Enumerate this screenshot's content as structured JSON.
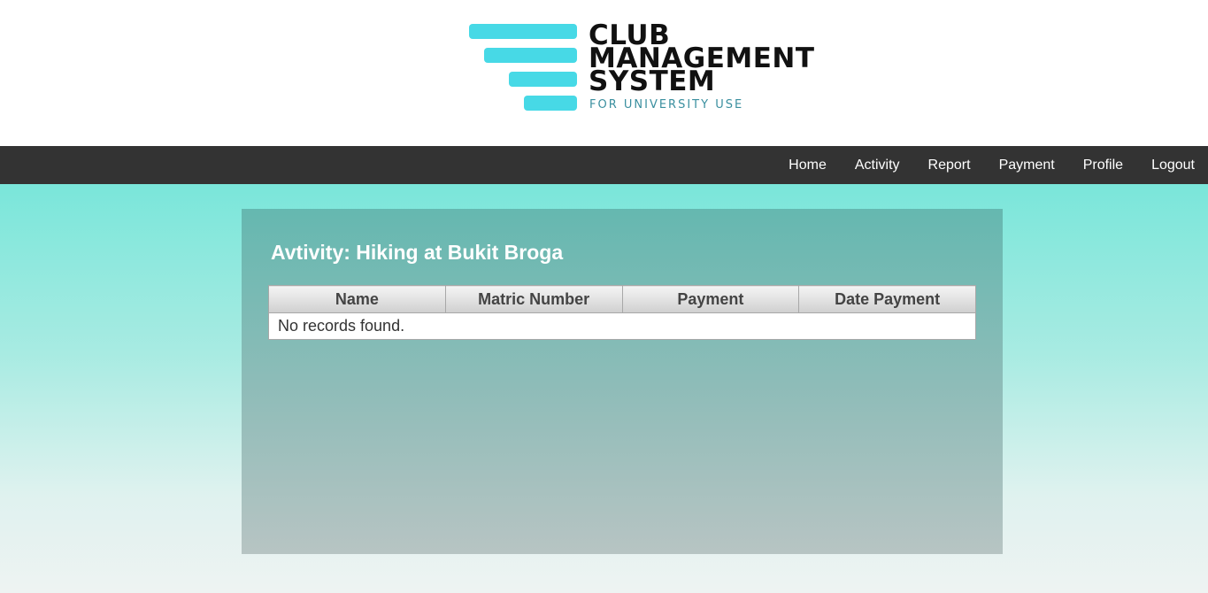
{
  "logo": {
    "line1": "CLUB",
    "line2": "MANAGEMENT",
    "line3": "SYSTEM",
    "tagline": "FOR UNIVERSITY USE",
    "accent_color": "#47d9e6"
  },
  "nav": {
    "items": [
      {
        "label": "Home"
      },
      {
        "label": "Activity"
      },
      {
        "label": "Report"
      },
      {
        "label": "Payment"
      },
      {
        "label": "Profile"
      },
      {
        "label": "Logout"
      }
    ]
  },
  "main": {
    "title": "Avtivity: Hiking at Bukit Broga",
    "table": {
      "columns": [
        "Name",
        "Matric Number",
        "Payment",
        "Date Payment"
      ],
      "empty_message": "No records found."
    }
  },
  "colors": {
    "navbar": "#333333",
    "background_top": "#7ae6da",
    "panel_top": "#65b8b0"
  }
}
